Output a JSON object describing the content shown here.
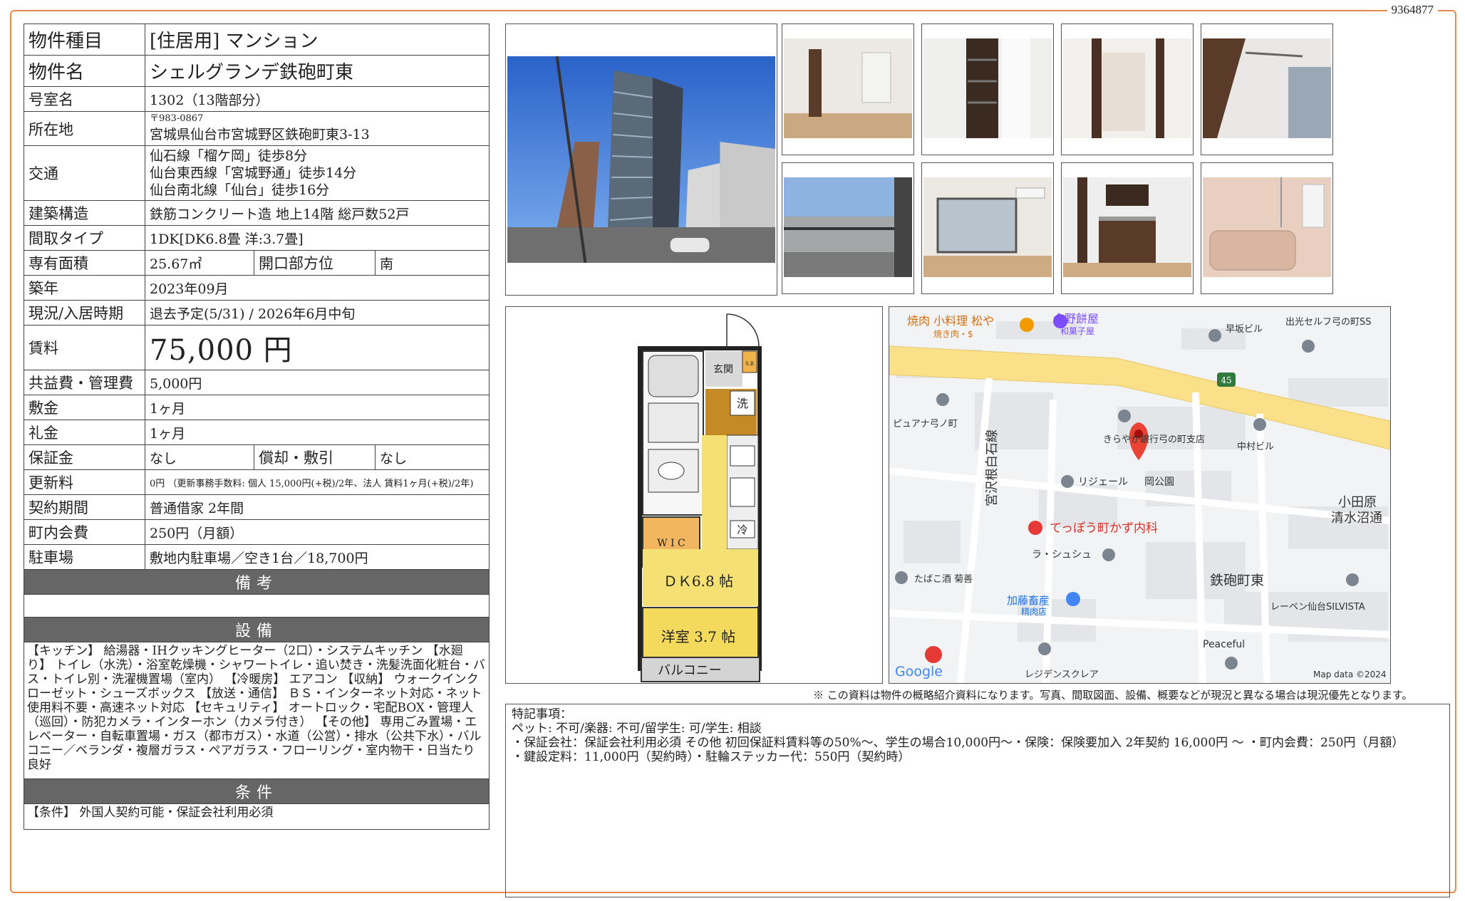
{
  "doc_id": "9364877",
  "property": {
    "type_label": "物件種目",
    "type_value": "[住居用]  マンション",
    "name_label": "物件名",
    "name_value": "シェルグランデ鉄砲町東",
    "room_label": "号室名",
    "room_value": "1302（13階部分）",
    "address_label": "所在地",
    "postal": "〒983-0867",
    "address": "宮城県仙台市宮城野区鉄砲町東3-13",
    "transport_label": "交通",
    "transport": [
      "仙石線「榴ケ岡」徒歩8分",
      "仙台東西線「宮城野通」徒歩14分",
      "仙台南北線「仙台」徒歩16分"
    ],
    "structure_label": "建築構造",
    "structure_value": "鉄筋コンクリート造  地上14階  総戸数52戸",
    "layout_label": "間取タイプ",
    "layout_value": "1DK[DK6.8畳  洋:3.7畳]",
    "area_label": "専有面積",
    "area_value": "25.67㎡",
    "direction_label": "開口部方位",
    "direction_value": "南",
    "built_label": "築年",
    "built_value": "2023年09月",
    "status_label": "現況/入居時期",
    "status_value": "退去予定(5/31)  /  2026年6月中旬",
    "rent_label": "賃料",
    "rent_value": "75,000  円",
    "fee_label": "共益費・管理費",
    "fee_value": "5,000円",
    "deposit_label": "敷金",
    "deposit_value": "1ヶ月",
    "keymoney_label": "礼金",
    "keymoney_value": "1ヶ月",
    "guarantee_label": "保証金",
    "guarantee_value": "なし",
    "amort_label": "償却・敷引",
    "amort_value": "なし",
    "renewal_label": "更新料",
    "renewal_value": "0円  （更新事務手数料: 個人 15,000円(+税)/2年、法人  賃料1ヶ月(+税)/2年)",
    "contract_label": "契約期間",
    "contract_value": "普通借家  2年間",
    "town_label": "町内会費",
    "town_value": "250円（月額）",
    "parking_label": "駐車場",
    "parking_value": "敷地内駐車場／空き1台／18,700円"
  },
  "sections": {
    "remarks_title": "備考",
    "equipment_title": "設備",
    "conditions_title": "条件"
  },
  "equipment_text": "【キッチン】 給湯器・IHクッキングヒーター（2口）・システムキッチン  【水廻り】 トイレ（水洗）・浴室乾燥機・シャワートイレ・追い焚き・洗髪洗面化粧台・バス・トイレ別・洗濯機置場（室内） 【冷暖房】 エアコン 【収納】 ウォークインクローゼット・シューズボックス 【放送・通信】 ＢＳ・インターネット対応・ネット使用料不要・高速ネット対応 【セキュリティ】 オートロック・宅配BOX・管理人（巡回）・防犯カメラ・インターホン（カメラ付き） 【その他】 専用ごみ置場・エレベーター・自転車置場・ガス（都市ガス）・水道（公営）・排水（公共下水）・バルコニー／ベランダ・複層ガラス・ペアガラス・フローリング・室内物干・日当たり良好",
  "conditions_text": "【条件】 外国人契約可能・保証会社利用必須",
  "floorplan": {
    "entrance": "玄関",
    "sb": "S.B",
    "wash": "洗",
    "wic": "W I C",
    "fridge": "冷",
    "dk": "ＤＫ6.8 帖",
    "western": "洋室 3.7 帖",
    "balcony": "バルコニー"
  },
  "map": {
    "labels": {
      "yakiniku": "焼肉 小料理 松や",
      "yakiniku_sub": "焼き肉・$",
      "imano": "今野餅屋",
      "imano_sub": "和菓子屋",
      "hayasaka": "早坂ビル",
      "idemitsu": "出光セルフ弓の町SS",
      "route": "45",
      "pure": "ピュアナ弓ノ町",
      "kirayaka": "きらやか銀行弓の町支店",
      "nakamura": "中村ビル",
      "rijeru": "リジェール",
      "koen": "岡公園",
      "odawara": "小田原",
      "shimizu": "清水沼通",
      "road": "宮沢根白石線",
      "clinic": "てっぽう町かず内科",
      "tabako": "たばこ酒 菊善",
      "lachouchou": "ラ・シュシュ",
      "teppo": "鉄砲町東",
      "kato": "加藤畜産",
      "kato_sub": "精肉店",
      "raven": "レーベン仙台SILVISTA",
      "peaceful": "Peaceful",
      "residence": "レジデンスクレア",
      "google": "Google",
      "mapdata": "Map data ©2024"
    }
  },
  "disclaimer": "※ この資料は物件の概略紹介資料になります。写真、間取図面、設備、概要などが現況と異なる場合は現況優先となります。",
  "remarks": {
    "title": "特記事項：",
    "lines": [
      "ペット: 不可/楽器: 不可/留学生: 可/学生: 相談",
      "・保証会社：保証会社利用必須  その他  初回保証料賃料等の50%～、学生の場合10,000円～・保険：保険要加入  2年契約  16,000円  ～  ・町内会費：250円（月額）",
      "・鍵設定料：11,000円（契約時）・駐輪ステッカー代：550円（契約時）"
    ]
  }
}
